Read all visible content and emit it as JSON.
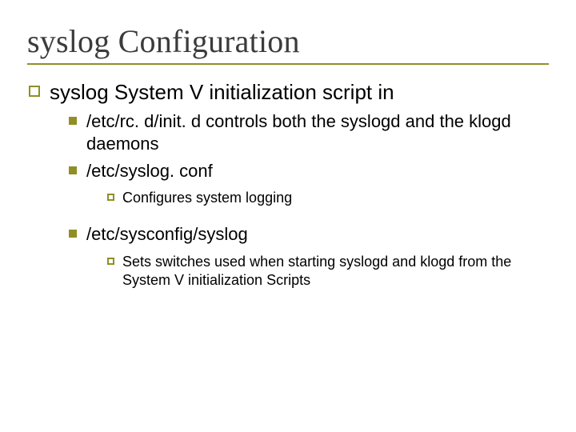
{
  "title": "syslog Configuration",
  "lvl1": {
    "text": "syslog  System V initialization script in"
  },
  "lvl2": {
    "a": "/etc/rc. d/init. d       controls both the syslogd and the klogd daemons",
    "b": "/etc/syslog. conf",
    "c": "/etc/sysconfig/syslog"
  },
  "lvl3": {
    "b1": "Configures system logging",
    "c1": "Sets switches used when starting syslogd and klogd from the System V initialization Scripts"
  }
}
